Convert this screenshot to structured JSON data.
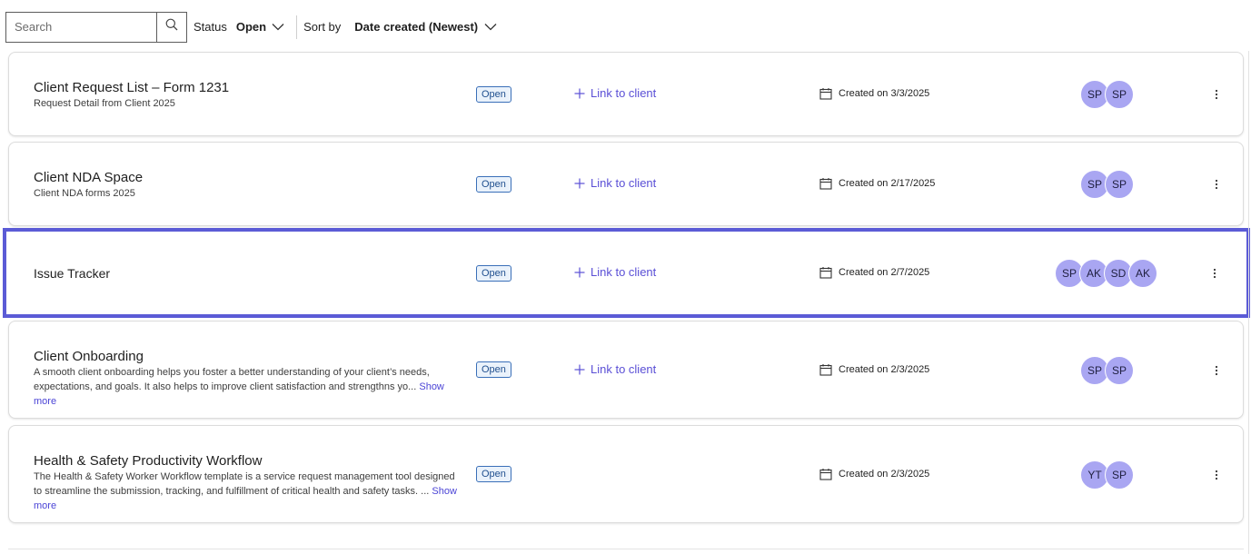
{
  "toolbar": {
    "search_placeholder": "Search",
    "status_label": "Status",
    "status_value": "Open",
    "sort_label": "Sort by",
    "sort_value": "Date created (Newest)"
  },
  "colors": {
    "accent": "#5b5bd6",
    "avatar": "#a9a6f2",
    "badge_border": "#3a6fb8",
    "link": "#5a4fd6"
  },
  "cards": [
    {
      "title": "Client Request List – Form 1231",
      "description": "Request Detail from Client 2025",
      "show_more": "",
      "status": "Open",
      "link_label": "Link to client",
      "created": "Created on 3/3/2025",
      "avatars": [
        "SP",
        "SP"
      ],
      "selected": false
    },
    {
      "title": "Client NDA Space",
      "description": "Client NDA forms 2025",
      "show_more": "",
      "status": "Open",
      "link_label": "Link to client",
      "created": "Created on 2/17/2025",
      "avatars": [
        "SP",
        "SP"
      ],
      "selected": false
    },
    {
      "title": "Issue Tracker",
      "description": "",
      "show_more": "",
      "status": "Open",
      "link_label": "Link to client",
      "created": "Created on 2/7/2025",
      "avatars": [
        "SP",
        "AK",
        "SD",
        "AK"
      ],
      "selected": true
    },
    {
      "title": "Client Onboarding",
      "description": "A smooth client onboarding helps you foster a better understanding of your client’s needs, expectations, and goals. It also helps to improve client satisfaction and strengthns yo...",
      "show_more": "Show more",
      "status": "Open",
      "link_label": "Link to client",
      "created": "Created on 2/3/2025",
      "avatars": [
        "SP",
        "SP"
      ],
      "selected": false
    },
    {
      "title": "Health & Safety Productivity Workflow",
      "description": "The Health & Safety Worker Workflow template is a service request management tool designed to streamline the submission, tracking, and fulfillment of critical health and safety tasks. ...",
      "show_more": "Show more",
      "status": "Open",
      "link_label": "",
      "created": "Created on 2/3/2025",
      "avatars": [
        "YT",
        "SP"
      ],
      "selected": false
    }
  ]
}
